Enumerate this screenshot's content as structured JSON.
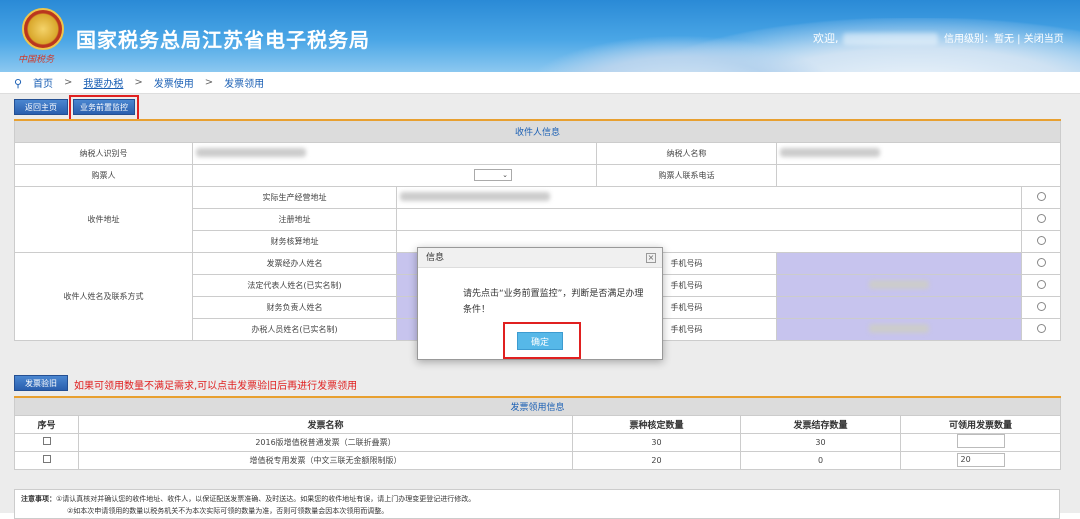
{
  "header": {
    "title": "国家税务总局江苏省电子税务局",
    "emblem_text": "中国税务",
    "welcome": "欢迎,",
    "credit": "信用级别：暂无 | 关闭当页"
  },
  "breadcrumb": {
    "home": "首页",
    "sep": ">",
    "items": [
      "我要办税",
      "发票使用",
      "发票领用"
    ]
  },
  "toolbar": {
    "back_label": "返回主页",
    "monitor_label": "业务前置监控"
  },
  "recipient": {
    "section_title": "收件人信息",
    "taxpayer_id_label": "纳税人识别号",
    "taxpayer_name_label": "纳税人名称",
    "buyer_label": "购票人",
    "buyer_phone_label": "购票人联系电话",
    "address_label": "收件地址",
    "address_rows": [
      "实际生产经营地址",
      "注册地址",
      "财务核算地址"
    ],
    "contact_label": "收件人姓名及联系方式",
    "contact_rows": [
      "发票经办人姓名",
      "法定代表人姓名(已实名制)",
      "财务负责人姓名",
      "办税人员姓名(已实名制)"
    ],
    "phone_label": "手机号码"
  },
  "validate": {
    "button_label": "发票验旧",
    "note": "如果可领用数量不满足需求,可以点击发票验旧后再进行发票领用"
  },
  "invoice_table": {
    "section_title": "发票领用信息",
    "columns": [
      "序号",
      "发票名称",
      "票种核定数量",
      "发票结存数量",
      "可领用发票数量"
    ],
    "rows": [
      {
        "name": "2016版增值税普通发票（二联折叠票）",
        "approved": "30",
        "balance": "30",
        "available": ""
      },
      {
        "name": "增值税专用发票（中文三联无金额限制版）",
        "approved": "20",
        "balance": "0",
        "available": "20"
      }
    ]
  },
  "notes": {
    "label": "注意事项：",
    "line1": "①请认真核对并确认您的收件地址、收件人，以保证配送发票准确、及时送达。如果您的收件地址有误，请上门办理变更登记进行修改。",
    "line2": "②如本次申请领用的数量以税务机关不为本次实际可领的数量为准，否则可领数量会因本次领用而调整。"
  },
  "dialog": {
    "title": "信息",
    "message": "请先点击“业务前置监控”，判断是否满足办理条件！",
    "ok_label": "确定",
    "close_glyph": "×"
  },
  "colors": {
    "banner": "#2a8ad6",
    "button_blue": "#2a5fae",
    "highlight_red": "#e02020",
    "section_header": "#dcdcdc",
    "ok_button": "#56b8e8"
  }
}
